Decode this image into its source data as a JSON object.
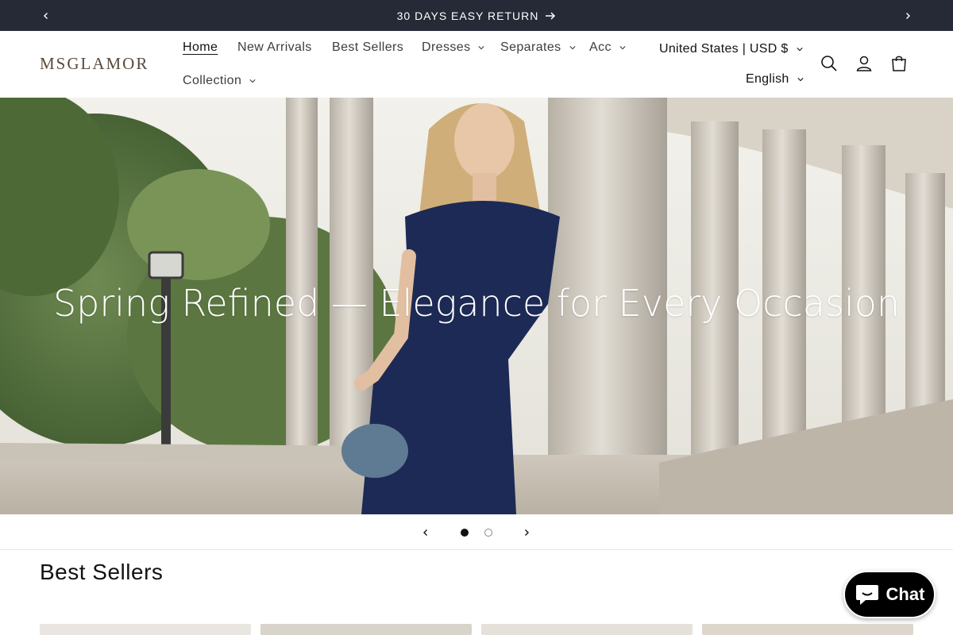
{
  "announcement": {
    "message": "30 DAYS EASY RETURN"
  },
  "header": {
    "logo": "MSGLAMOR",
    "nav": [
      {
        "label": "Home",
        "active": true
      },
      {
        "label": "New Arrivals"
      },
      {
        "label": "Best Sellers"
      },
      {
        "label": "Dresses",
        "dropdown": true
      },
      {
        "label": "Separates",
        "dropdown": true
      },
      {
        "label": "Acc",
        "dropdown": true
      },
      {
        "label": "Collection",
        "dropdown": true
      }
    ],
    "country": "United States | USD $",
    "language": "English",
    "icons": [
      "search-icon",
      "account-icon",
      "cart-icon"
    ]
  },
  "hero": {
    "title": "Spring Refined — Elegance for Every Occasion",
    "slides": 2,
    "current_slide": 1
  },
  "best_sellers": {
    "title": "Best Sellers"
  },
  "chat": {
    "label": "Chat"
  },
  "colors": {
    "announcement_bg": "#262a36",
    "dress": "#1d2a55",
    "chat_bg": "#000000"
  }
}
